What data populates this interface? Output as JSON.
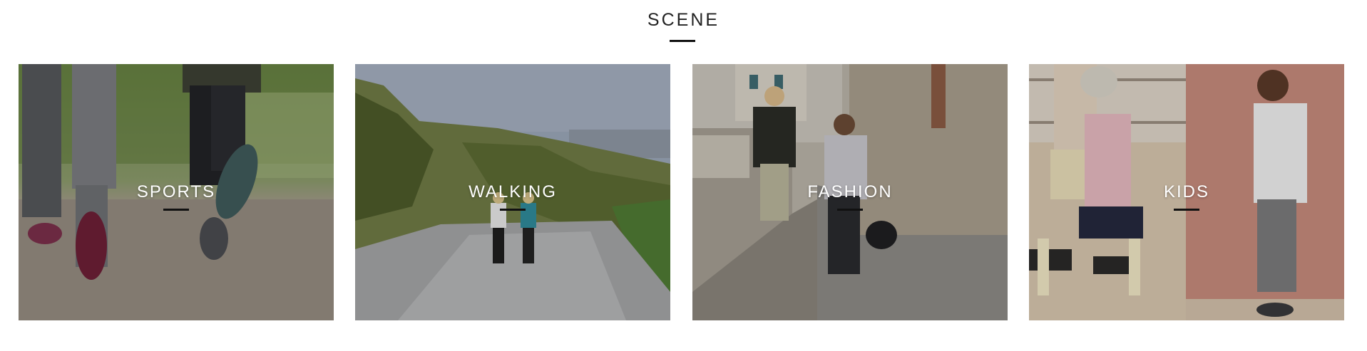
{
  "section": {
    "title": "SCENE"
  },
  "cards": [
    {
      "label": "SPORTS",
      "image": "runners-legs-on-trail-photo"
    },
    {
      "label": "WALKING",
      "image": "two-women-walking-on-hill-road-photo"
    },
    {
      "label": "FASHION",
      "image": "couple-holding-hands-in-old-town-photo"
    },
    {
      "label": "KIDS",
      "image": "two-children-walking-by-pink-wall-photo"
    }
  ],
  "colors": {
    "title_text": "#222222",
    "underline": "#111111",
    "label_text": "#ffffff"
  }
}
